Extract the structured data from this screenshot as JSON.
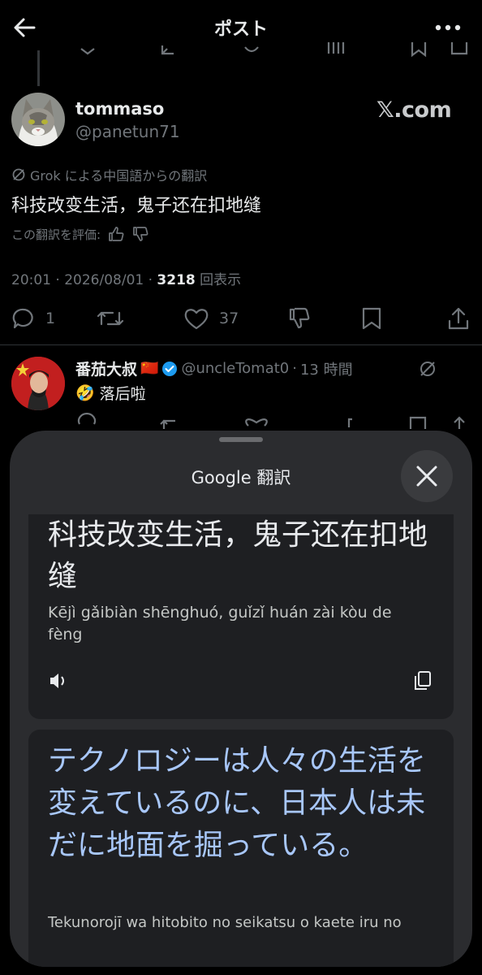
{
  "header": {
    "title": "ポスト",
    "back_icon": "back-arrow-icon",
    "more_icon": "more-icon"
  },
  "post": {
    "author_name": "tommaso",
    "author_handle": "@panetun71",
    "watermark": "𝕏.com",
    "translation_note": "Grok による中国語からの翻訳",
    "text": "科技改变生活，鬼子还在扣地缝",
    "rate_label": "この翻訳を評価:",
    "time": "20:01",
    "date": "2026/08/01",
    "views_count": "3218",
    "views_label": "回表示",
    "stats": {
      "replies": "1",
      "likes": "37"
    }
  },
  "reply": {
    "name": "番茄大叔",
    "flag": "🇨🇳",
    "handle": "@uncleTomat0",
    "time": "13 時間",
    "emoji": "🤣",
    "text": "落后啦"
  },
  "translate_sheet": {
    "title": "Google 翻訳",
    "source_text": "科技改变生活，鬼子还在扣地缝",
    "source_romanization": "Kējì gǎibiàn shēnghuó, guǐzǐ huán zài kòu de fèng",
    "translated_text": "テクノロジーは人々の生活を変えているのに、日本人は未だに地面を掘っている。",
    "translated_romanization": "Tekunorojī wa hitobito no seikatsu o kaete iru no"
  },
  "colors": {
    "background": "#000000",
    "secondary_text": "#71767b",
    "verified": "#1d9bf0",
    "translation_blue": "#a8c7fa",
    "sheet_bg": "#2b2c2f"
  }
}
